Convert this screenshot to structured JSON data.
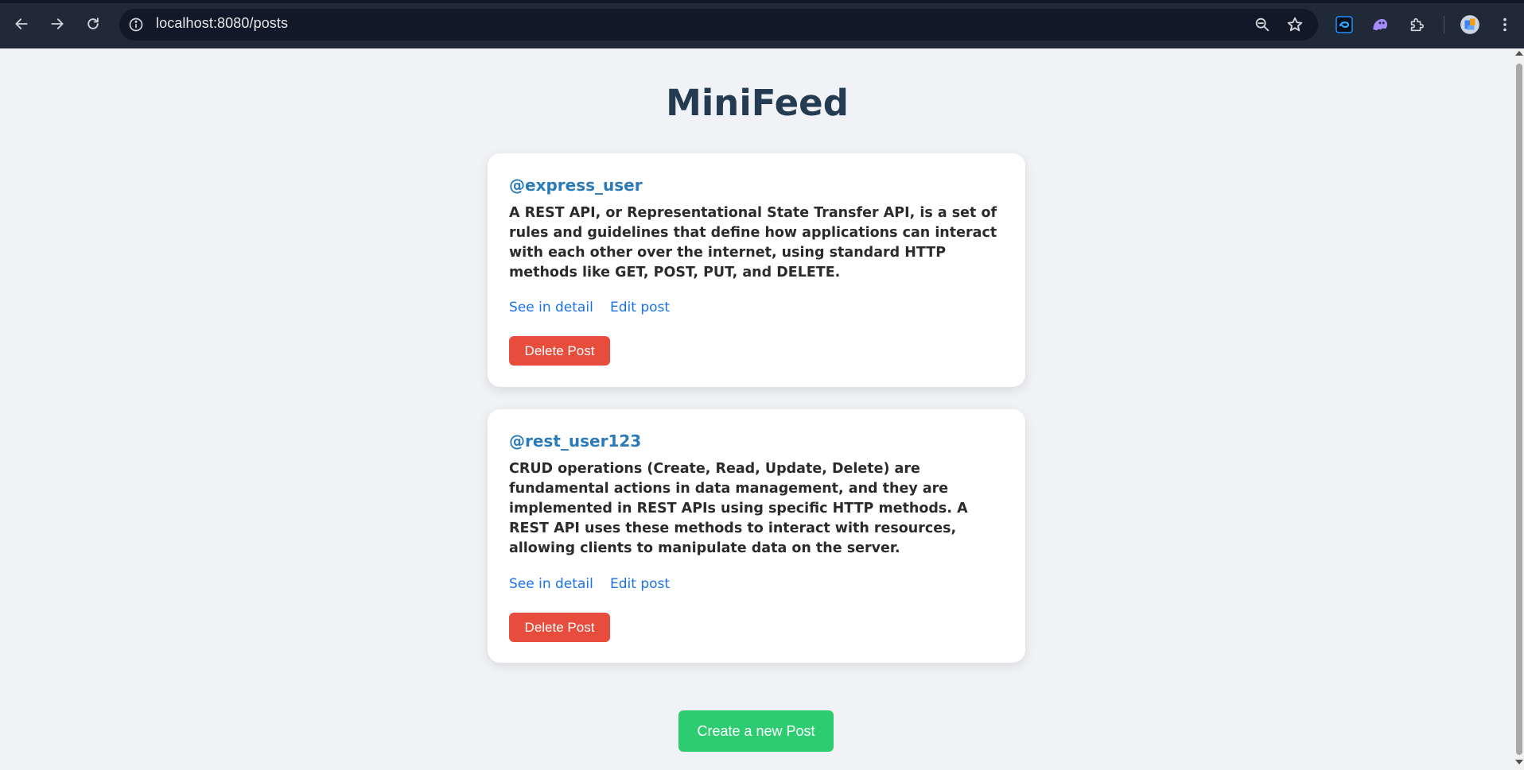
{
  "browser": {
    "url": "localhost:8080/posts",
    "icons": [
      "back-arrow-icon",
      "forward-arrow-icon",
      "reload-icon",
      "site-info-icon",
      "zoom-icon",
      "bookmark-star-icon",
      "extension-blue-icon",
      "extension-ghost-icon",
      "extensions-puzzle-icon",
      "profile-avatar-icon",
      "menu-kebab-icon"
    ]
  },
  "page": {
    "title": "MiniFeed",
    "posts": [
      {
        "username": "@express_user",
        "content": "A REST API, or Representational State Transfer API, is a set of rules and guidelines that define how applications can interact with each other over the internet, using standard HTTP methods like GET, POST, PUT, and DELETE.",
        "detail_link": "See in detail",
        "edit_link": "Edit post",
        "delete_label": "Delete Post"
      },
      {
        "username": "@rest_user123",
        "content": "CRUD operations (Create, Read, Update, Delete) are fundamental actions in data management, and they are implemented in REST APIs using specific HTTP methods. A REST API uses these methods to interact with resources, allowing clients to manipulate data on the server.",
        "detail_link": "See in detail",
        "edit_link": "Edit post",
        "delete_label": "Delete Post"
      }
    ],
    "create_label": "Create a new Post"
  },
  "colors": {
    "title": "#253b52",
    "username": "#2b7bb9",
    "link": "#1a73e8",
    "delete": "#e74c3c",
    "create": "#2ecc71",
    "background": "#f0f2f5"
  }
}
